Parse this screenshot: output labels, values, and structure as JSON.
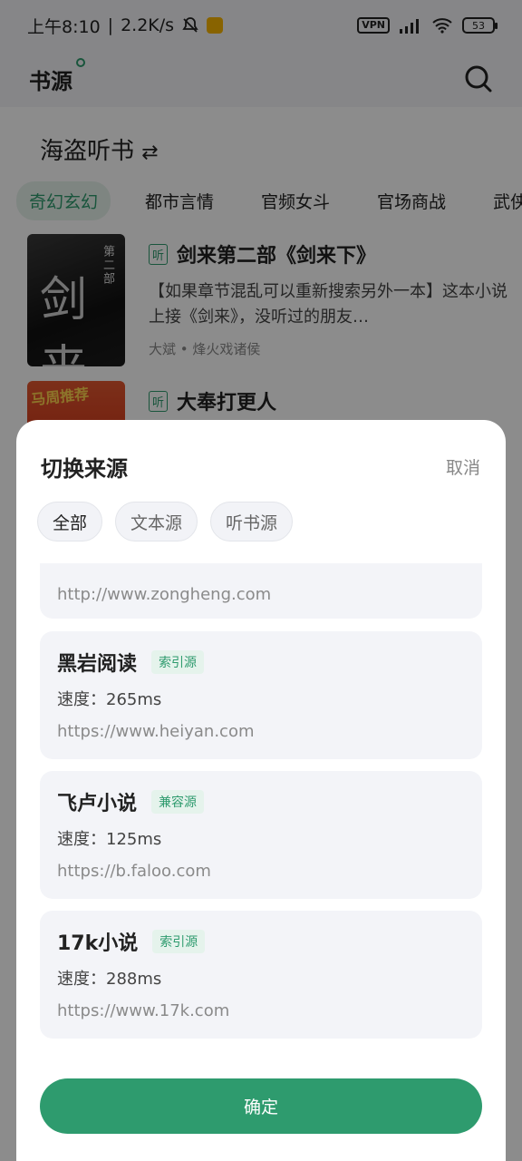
{
  "status_bar": {
    "time": "上午8:10",
    "speed": "2.2K/s",
    "vpn": "VPN",
    "battery": "53"
  },
  "header": {
    "title": "书源"
  },
  "source": {
    "name": "海盗听书"
  },
  "categories": [
    "奇幻玄幻",
    "都市言情",
    "官频女斗",
    "官场商战",
    "武侠仙"
  ],
  "books": [
    {
      "tag": "听",
      "title": "剑来第二部《剑来下》",
      "desc": "【如果章节混乱可以重新搜索另外一本】这本小说上接《剑来》，没听过的朋友…",
      "meta": "大斌 • 烽火戏诸侯",
      "cover_big": "剑来",
      "cover_small": "第二部"
    },
    {
      "tag": "听",
      "title": "大奉打更人",
      "cover_small": "马周推荐"
    }
  ],
  "sheet": {
    "title": "切换来源",
    "cancel": "取消",
    "filters": [
      "全部",
      "文本源",
      "听书源"
    ],
    "partial_url": "http://www.zongheng.com",
    "items": [
      {
        "name": "黑岩阅读",
        "badge": "索引源",
        "speed": "速度：265ms",
        "url": "https://www.heiyan.com"
      },
      {
        "name": "飞卢小说",
        "badge": "兼容源",
        "speed": "速度：125ms",
        "url": "https://b.faloo.com"
      },
      {
        "name": "17k小说",
        "badge": "索引源",
        "speed": "速度：288ms",
        "url": "https://www.17k.com"
      }
    ],
    "confirm": "确定"
  }
}
